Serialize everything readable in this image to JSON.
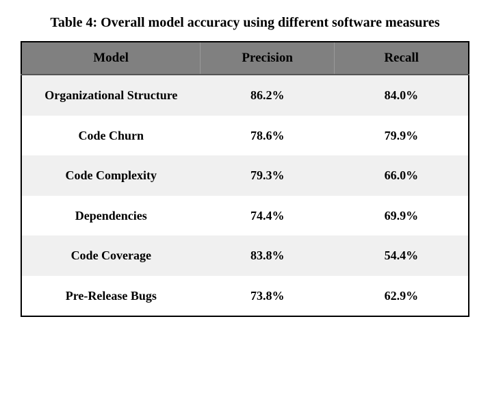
{
  "chart_data": {
    "type": "table",
    "title": "Table 4: Overall model accuracy using different software measures",
    "headers": [
      "Model",
      "Precision",
      "Recall"
    ],
    "rows": [
      {
        "model": "Organizational Structure",
        "precision": "86.2%",
        "recall": "84.0%"
      },
      {
        "model": "Code Churn",
        "precision": "78.6%",
        "recall": "79.9%"
      },
      {
        "model": "Code Complexity",
        "precision": "79.3%",
        "recall": "66.0%"
      },
      {
        "model": "Dependencies",
        "precision": "74.4%",
        "recall": "69.9%"
      },
      {
        "model": "Code Coverage",
        "precision": "83.8%",
        "recall": "54.4%"
      },
      {
        "model": "Pre-Release Bugs",
        "precision": "73.8%",
        "recall": "62.9%"
      }
    ]
  }
}
